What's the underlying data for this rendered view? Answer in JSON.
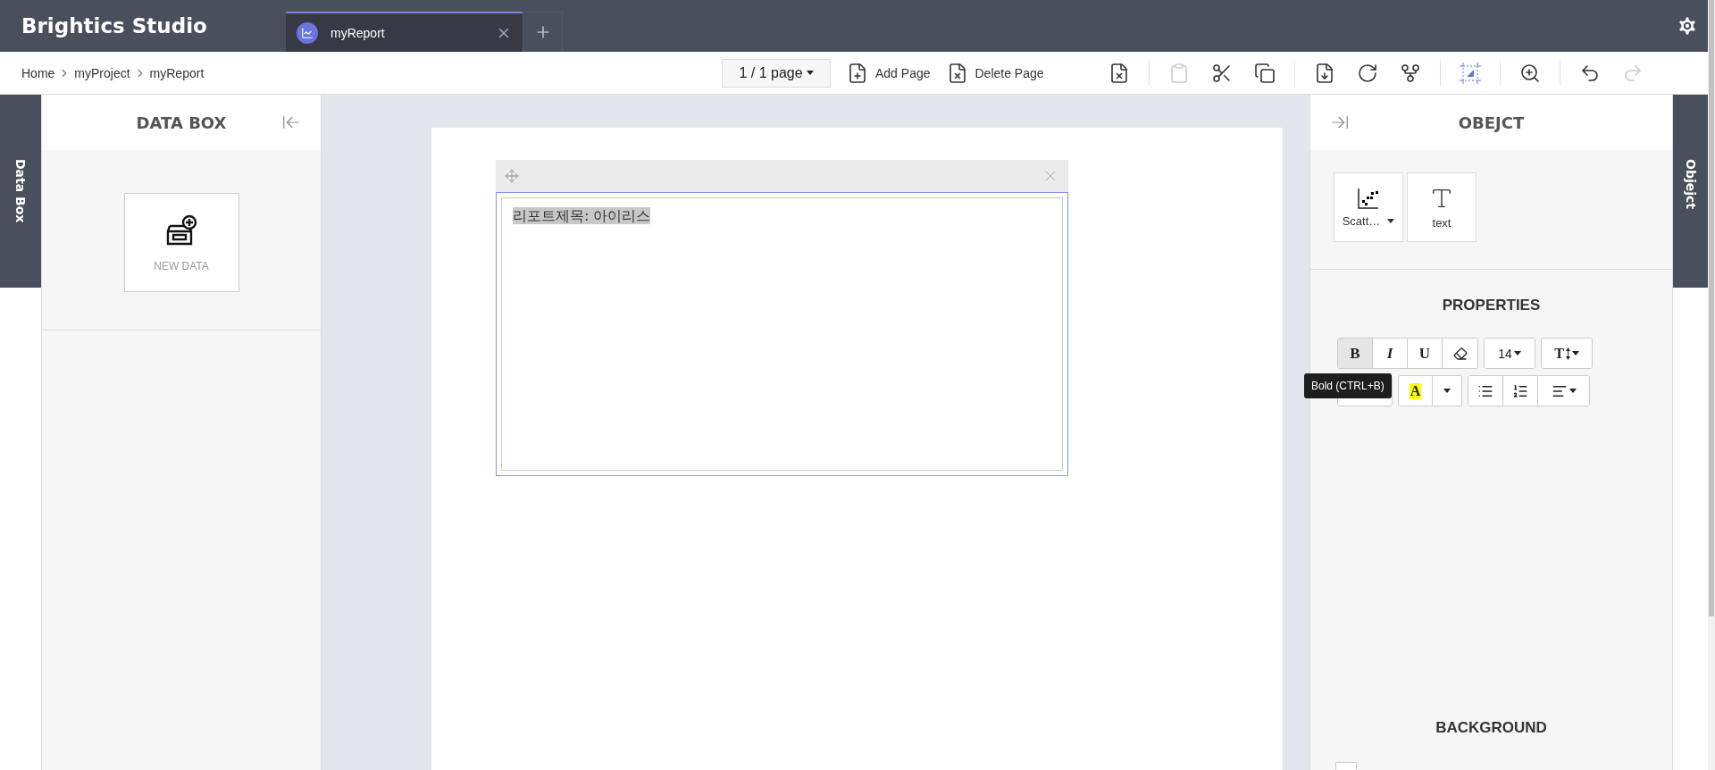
{
  "app": {
    "title": "Brightics Studio"
  },
  "tabs": [
    {
      "label": "myReport",
      "selected": true
    }
  ],
  "breadcrumb": [
    "Home",
    "myProject",
    "myReport"
  ],
  "toolbar": {
    "page_selector": "1 / 1 page",
    "page_buttons": [
      {
        "kind": "add",
        "label": "Add Page"
      },
      {
        "kind": "delete",
        "label": "Delete Page"
      }
    ],
    "tool_groups": [
      [
        {
          "kind": "remove",
          "disabled": false,
          "selected": false
        }
      ],
      [
        {
          "kind": "paste",
          "disabled": true,
          "selected": false
        },
        {
          "kind": "cut",
          "disabled": false,
          "selected": false
        },
        {
          "kind": "copy",
          "disabled": false,
          "selected": false
        }
      ],
      [
        {
          "kind": "pdf",
          "disabled": false,
          "selected": false
        },
        {
          "kind": "refresh",
          "disabled": false,
          "selected": false
        },
        {
          "kind": "branch",
          "disabled": false,
          "selected": false
        }
      ],
      [
        {
          "kind": "select",
          "disabled": false,
          "selected": true
        }
      ],
      [
        {
          "kind": "zoom",
          "disabled": false,
          "selected": false
        }
      ],
      [
        {
          "kind": "undo",
          "disabled": false,
          "selected": false
        },
        {
          "kind": "redo",
          "disabled": true,
          "selected": false
        }
      ]
    ]
  },
  "data_box": {
    "side_tab": "Data Box",
    "title": "DATA BOX",
    "new_data": "NEW DATA"
  },
  "canvas": {
    "widget": {
      "text": "리포트제목: 아이리스",
      "highlighted": true
    }
  },
  "object_panel": {
    "side_tab": "Objejct",
    "title": "OBEJCT",
    "objects": [
      {
        "kind": "scatter",
        "label": "Scatt…",
        "has_menu": true
      },
      {
        "kind": "text",
        "label": "text",
        "has_menu": false
      }
    ]
  },
  "properties": {
    "title": "PROPERTIES",
    "row_1": [
      {
        "kind": "bold",
        "label": "B",
        "selected": true
      },
      {
        "kind": "italic",
        "label": "I",
        "selected": false
      },
      {
        "kind": "underline",
        "label": "U",
        "selected": false
      },
      {
        "kind": "eraser",
        "selected": false
      }
    ],
    "font_size": "14",
    "text_size": "T",
    "tooltip": "Bold (CTRL+B)",
    "highlight": "A",
    "row_2": [
      {
        "kind": "bullets"
      },
      {
        "kind": "numbers"
      },
      {
        "kind": "align"
      }
    ]
  },
  "background": {
    "title": "BACKGROUND",
    "checkbox": {
      "checked": false
    }
  }
}
